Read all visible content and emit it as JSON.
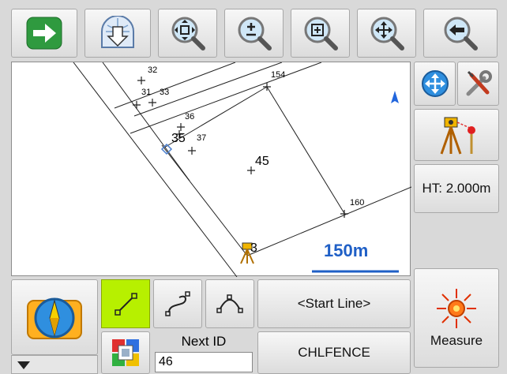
{
  "toolbar": {
    "icons": [
      "arrow-right-icon",
      "download-globe-icon",
      "zoom-extents-icon",
      "zoom-in-out-icon",
      "zoom-window-icon",
      "pan-icon",
      "back-icon"
    ]
  },
  "map": {
    "points": [
      {
        "label": "32"
      },
      {
        "label": "31"
      },
      {
        "label": "33"
      },
      {
        "label": "154"
      },
      {
        "label": "36"
      },
      {
        "label": "35"
      },
      {
        "label": "37"
      },
      {
        "label": "45"
      },
      {
        "label": "160"
      },
      {
        "label": "3"
      }
    ],
    "scale_label": "150m"
  },
  "right_panel": {
    "ht_label": "HT: 2.000m",
    "measure_label": "Measure"
  },
  "bottom": {
    "start_line": "<Start Line>",
    "next_id_label": "Next ID",
    "next_id_value": "46",
    "code_label": "CHLFENCE"
  },
  "colors": {
    "accent_green": "#b7f000",
    "scale_blue": "#1f5fc6",
    "north_blue": "#2266dd"
  }
}
